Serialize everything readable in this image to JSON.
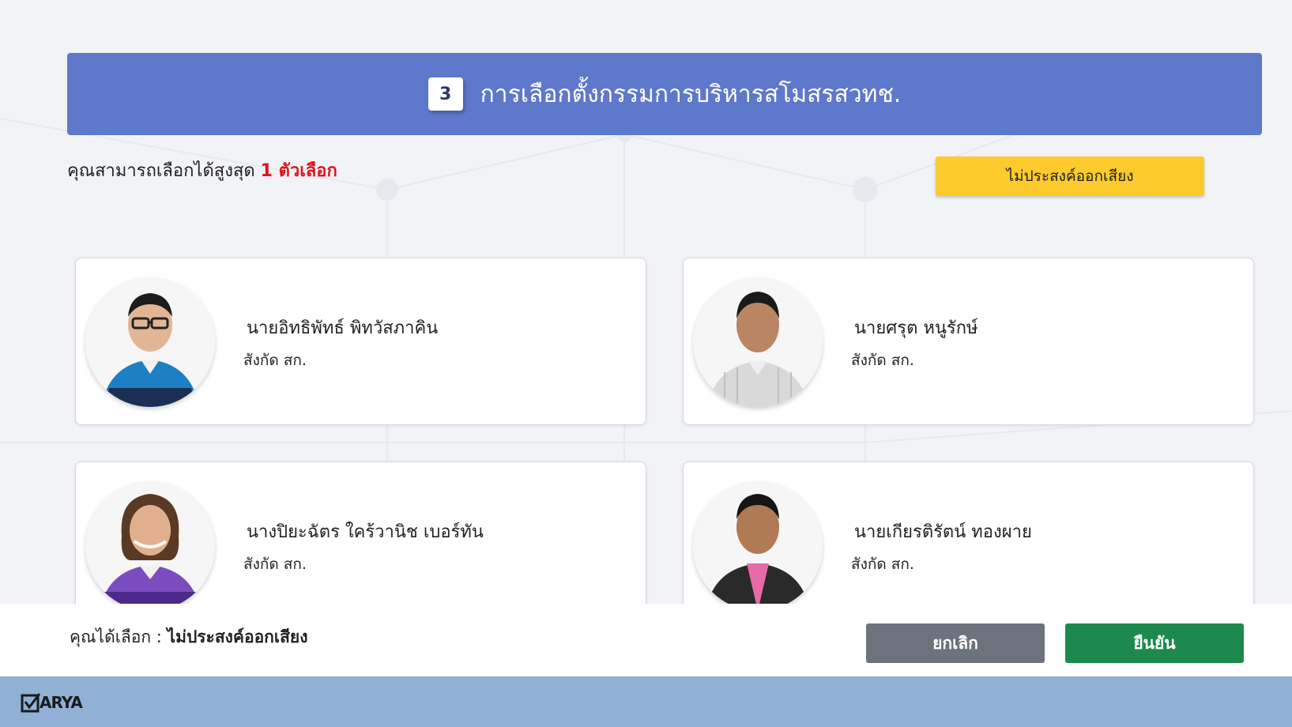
{
  "header": {
    "step_number": "3",
    "title": "การเลือกตั้งกรรมการบริหารสโมสรสวทช."
  },
  "selection_limit": {
    "prefix": "คุณสามารถเลือกได้สูงสุด",
    "value": "1 ตัวเลือก"
  },
  "abstain_button_label": "ไม่ประสงค์ออกเสียง",
  "candidates": [
    {
      "name": "นายอิทธิพัทธ์ พิทวัสภาคิน",
      "affiliation": "สังกัด สก."
    },
    {
      "name": "นายศรุต หนูรักษ์",
      "affiliation": "สังกัด สก."
    },
    {
      "name": "นางปิยะฉัตร ใคร้วานิช เบอร์ทัน",
      "affiliation": "สังกัด สก."
    },
    {
      "name": "นายเกียรติรัตน์ ทองผาย",
      "affiliation": "สังกัด สก."
    }
  ],
  "bottom_bar": {
    "selected_prefix": "คุณได้เลือก :",
    "selected_value": "ไม่ประสงค์ออกเสียง",
    "cancel_label": "ยกเลิก",
    "confirm_label": "ยืนยัน"
  },
  "footer": {
    "logo_text": "ARYA"
  },
  "colors": {
    "header": "#5e78cb",
    "limit_highlight": "#e0121a",
    "abstain_button": "#fcca2c",
    "cancel_button": "#6c737c",
    "confirm_button": "#1d8a4d",
    "footer": "#90b0d6"
  }
}
